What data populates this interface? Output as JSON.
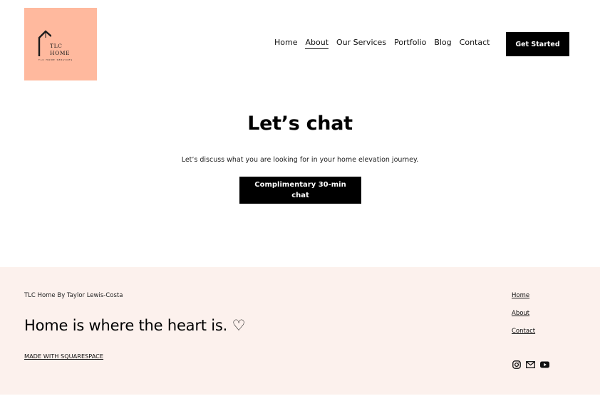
{
  "logo": {
    "line1": "TLC",
    "line2": "HOME",
    "tagline": "TLC HOME SERVICES",
    "bg_color": "#ffb99e"
  },
  "nav": {
    "items": [
      {
        "label": "Home",
        "active": false
      },
      {
        "label": "About",
        "active": true
      },
      {
        "label": "Our Services",
        "active": false
      },
      {
        "label": "Portfolio",
        "active": false
      },
      {
        "label": "Blog",
        "active": false
      },
      {
        "label": "Contact",
        "active": false
      }
    ],
    "cta_label": "Get Started"
  },
  "hero": {
    "title": "Let’s chat",
    "subtitle": "Let’s discuss what you are looking for in your home elevation journey.",
    "button_label": "Complimentary 30-min chat"
  },
  "footer": {
    "bg_color": "#fcf1ed",
    "brand": "TLC Home By Taylor Lewis-Costa",
    "tagline": "Home is where the heart is. ♡",
    "made_with": "MADE WITH SQUARESPACE",
    "links": [
      "Home",
      "About",
      "Contact"
    ],
    "social_icons": [
      "instagram-icon",
      "email-icon",
      "youtube-icon"
    ]
  }
}
